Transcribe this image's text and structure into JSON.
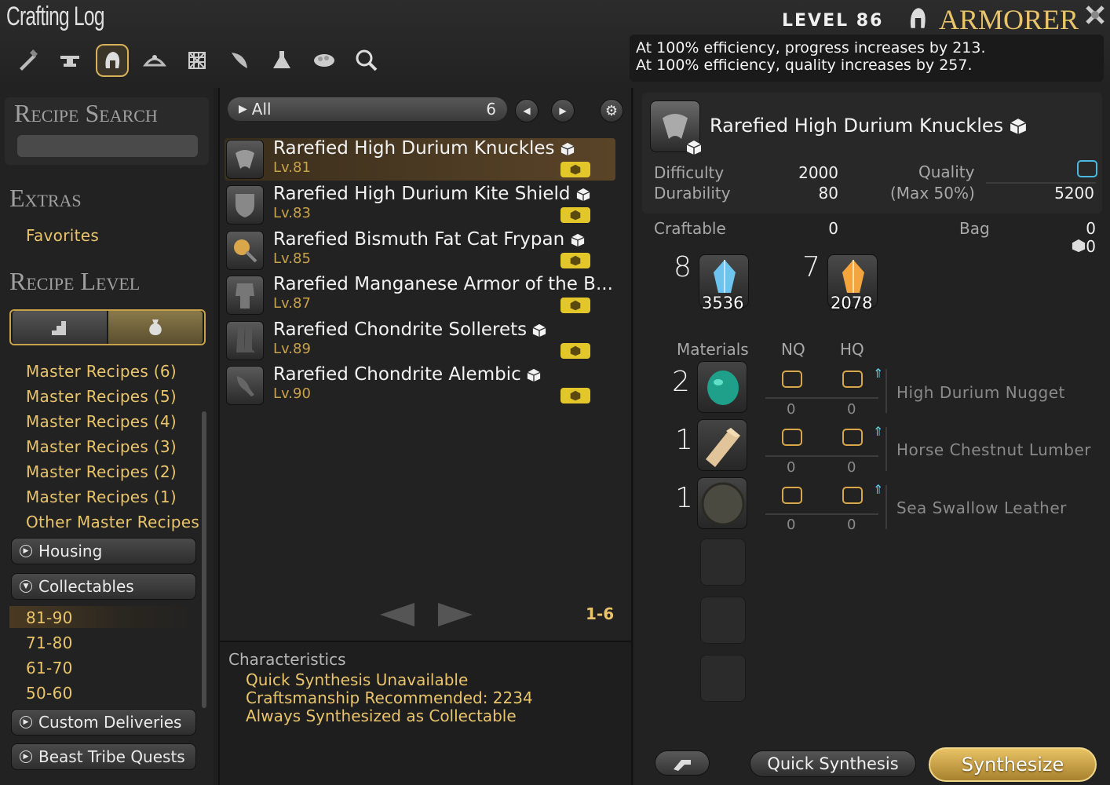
{
  "window": {
    "title": "Crafting Log"
  },
  "header": {
    "level_text": "LEVEL 86",
    "job": "ARMORER",
    "efficiency": [
      "At 100% efficiency, progress increases by 213.",
      "At 100% efficiency, quality increases by 257."
    ],
    "category_icons": [
      "carpenter-hammer-icon",
      "anvil-icon",
      "armorer-helm-icon",
      "goldsmith-tiara-icon",
      "weaver-loom-icon",
      "leather-knife-icon",
      "alchemist-flask-icon",
      "culinarian-pot-icon",
      "search-icon"
    ]
  },
  "sidebar": {
    "recipe_search": "Recipe Search",
    "extras": "Extras",
    "favorites": "Favorites",
    "recipe_level": "Recipe Level",
    "master_items": [
      "Master Recipes (6)",
      "Master Recipes (5)",
      "Master Recipes (4)",
      "Master Recipes (3)",
      "Master Recipes (2)",
      "Master Recipes (1)",
      "Other Master Recipes"
    ],
    "housing": "Housing",
    "collectables": "Collectables",
    "level_ranges": [
      "81-90",
      "71-80",
      "61-70",
      "50-60"
    ],
    "custom_deliveries": "Custom Deliveries",
    "beast_tribe": "Beast Tribe Quests"
  },
  "list": {
    "filter": "All",
    "count": "6",
    "page_range": "1-6",
    "recipes": [
      {
        "name": "Rarefied High Durium Knuckles",
        "level": "Lv.81"
      },
      {
        "name": "Rarefied High Durium Kite Shield",
        "level": "Lv.83"
      },
      {
        "name": "Rarefied Bismuth Fat Cat Frypan",
        "level": "Lv.85"
      },
      {
        "name": "Rarefied Manganese Armor of the B...",
        "level": "Lv.87"
      },
      {
        "name": "Rarefied Chondrite Sollerets",
        "level": "Lv.89"
      },
      {
        "name": "Rarefied Chondrite Alembic",
        "level": "Lv.90"
      }
    ]
  },
  "characteristics": {
    "title": "Characteristics",
    "lines": [
      "Quick Synthesis Unavailable",
      "Craftsmanship Recommended: 2234",
      "Always Synthesized as Collectable"
    ]
  },
  "detail": {
    "item_name": "Rarefied High Durium Knuckles",
    "difficulty_label": "Difficulty",
    "difficulty": "2000",
    "durability_label": "Durability",
    "durability": "80",
    "quality_label": "Quality",
    "max_label": "(Max 50%)",
    "quality_max": "5200",
    "craftable_label": "Craftable",
    "craftable": "0",
    "bag_label": "Bag",
    "bag": "0",
    "bag_collectable": "0",
    "crystals": [
      {
        "needed": "8",
        "have": "3536",
        "color": "#5fb8e8"
      },
      {
        "needed": "7",
        "have": "2078",
        "color": "#f0a040"
      }
    ],
    "materials_label": "Materials",
    "nq_label": "NQ",
    "hq_label": "HQ",
    "materials": [
      {
        "qty": "2",
        "name": "High Durium Nugget",
        "nq": "0",
        "hq": "0"
      },
      {
        "qty": "1",
        "name": "Horse Chestnut Lumber",
        "nq": "0",
        "hq": "0"
      },
      {
        "qty": "1",
        "name": "Sea Swallow Leather",
        "nq": "0",
        "hq": "0"
      }
    ]
  },
  "buttons": {
    "quick_synthesis": "Quick Synthesis",
    "synthesize": "Synthesize"
  }
}
